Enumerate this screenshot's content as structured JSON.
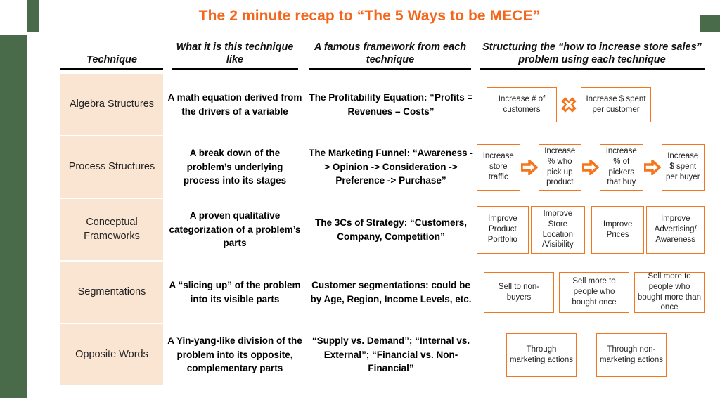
{
  "title": "The 2 minute recap to “The 5 Ways to be MECE”",
  "colors": {
    "accent_orange": "#f4661b",
    "box_border_orange": "#f4751b",
    "technique_cell_bg": "#fae5d3",
    "page_bg": "#ffffff",
    "canvas_bg": "#4a6b4a"
  },
  "headers": {
    "technique": "Technique",
    "what_it_is": "What it is this technique like",
    "framework": "A famous framework from each technique",
    "structuring": "Structuring the “how to increase store sales” problem using each technique"
  },
  "rows": [
    {
      "technique": "Algebra Structures",
      "what_it_is": "A math equation derived from the drivers of a variable",
      "framework": "The Profitability Equation: “Profits = Revenues – Costs”",
      "diagram": {
        "type": "multiply",
        "boxes": [
          "Increase # of customers",
          "Increase $ spent per customer"
        ],
        "connector": "x-multiply-icon"
      }
    },
    {
      "technique": "Process Structures",
      "what_it_is": "A break down of the problem’s underlying process into its stages",
      "framework": "The Marketing Funnel: “Awareness -> Opinion -> Consideration -> Preference -> Purchase”",
      "diagram": {
        "type": "flow",
        "boxes": [
          "Increase store traffic",
          "Increase % who pick up product",
          "Increase % of pickers that buy",
          "Increase $ spent per buyer"
        ],
        "connector": "arrow-right-icon"
      }
    },
    {
      "technique": "Conceptual Frameworks",
      "what_it_is": "A proven qualitative categorization of a problem’s parts",
      "framework": "The 3Cs of Strategy: “Customers, Company, Competition”",
      "diagram": {
        "type": "adjacent",
        "boxes": [
          "Improve Product Portfolio",
          "Improve Store Location /Visibility",
          "Improve Prices",
          "Improve Advertising/ Awareness"
        ],
        "connector": "none"
      }
    },
    {
      "technique": "Segmentations",
      "what_it_is": "A “slicing up” of the problem into its visible parts",
      "framework": "Customer segmentations: could be by Age, Region, Income Levels, etc.",
      "diagram": {
        "type": "adjacent",
        "boxes": [
          "Sell to non-buyers",
          "Sell more to people who bought once",
          "Sell more to people who bought more than once"
        ],
        "connector": "none"
      }
    },
    {
      "technique": "Opposite Words",
      "what_it_is": "A Yin-yang-like division of the problem into its opposite, complementary parts",
      "framework": "“Supply vs. Demand”; “Internal vs. External”; “Financial vs. Non-Financial”",
      "diagram": {
        "type": "pair",
        "boxes": [
          "Through marketing actions",
          "Through non-marketing actions"
        ],
        "connector": "none"
      }
    }
  ]
}
